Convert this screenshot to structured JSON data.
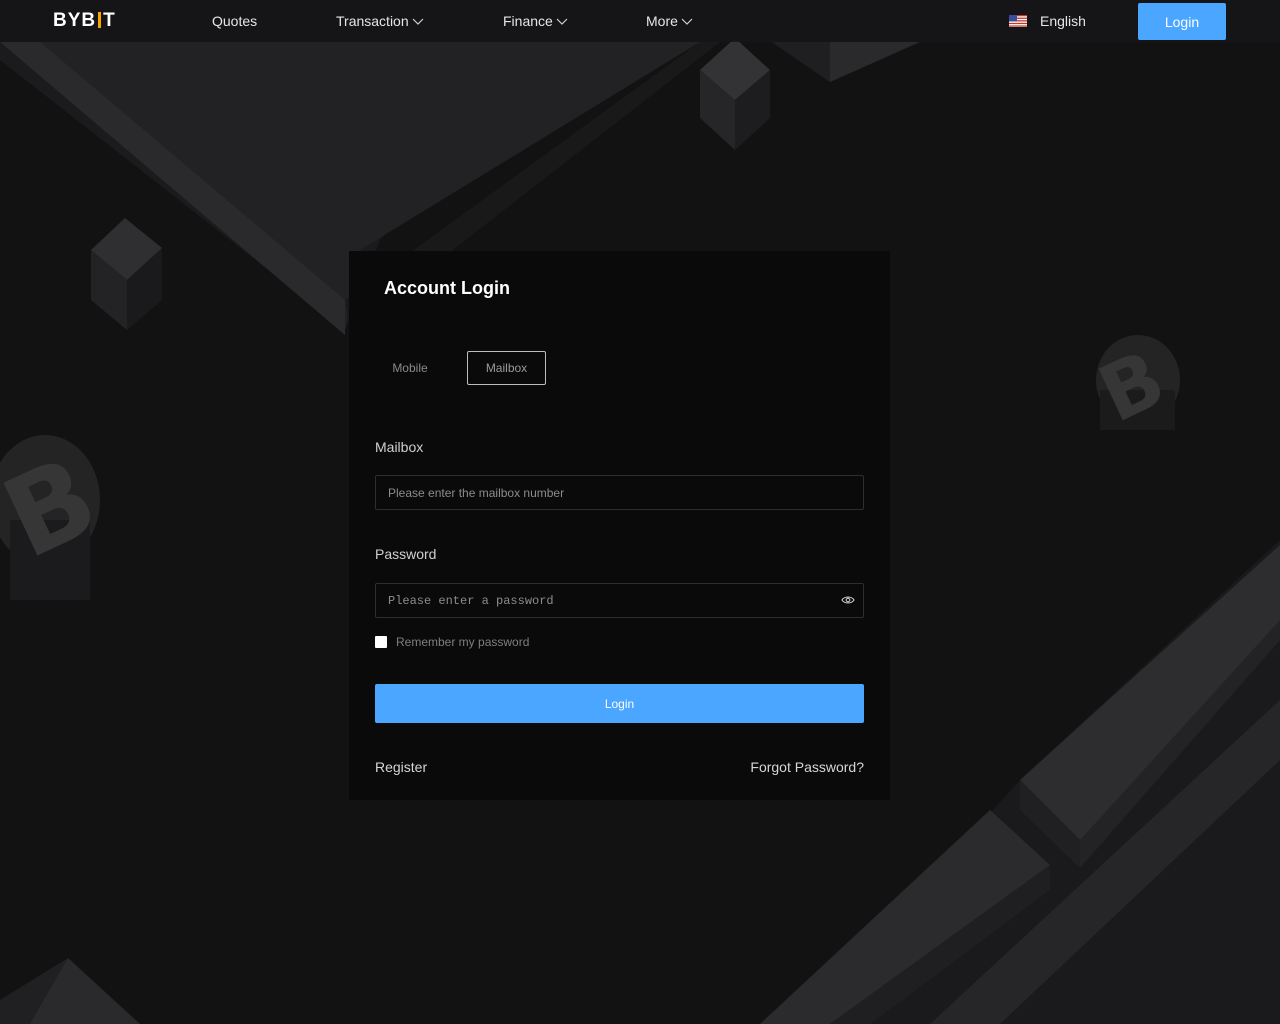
{
  "header": {
    "logo_left": "BYB",
    "logo_right": "T",
    "nav": [
      {
        "label": "Quotes",
        "has_dropdown": false
      },
      {
        "label": "Transaction",
        "has_dropdown": true
      },
      {
        "label": "Finance",
        "has_dropdown": true
      },
      {
        "label": "More",
        "has_dropdown": true
      }
    ],
    "language": {
      "label": "English",
      "flag_icon": "us-flag-icon"
    },
    "login_label": "Login"
  },
  "colors": {
    "accent": "#4aa6ff",
    "logo_accent": "#f7a600",
    "background": "#121213",
    "card_background": "#0a0a0b"
  },
  "login_card": {
    "title": "Account Login",
    "tabs": [
      {
        "label": "Mobile",
        "active": false
      },
      {
        "label": "Mailbox",
        "active": true
      }
    ],
    "mailbox_label": "Mailbox",
    "mailbox_placeholder": "Please enter the mailbox number",
    "password_label": "Password",
    "password_placeholder": "Please enter a password",
    "password_toggle_icon": "eye-icon",
    "remember_label": "Remember my password",
    "remember_checked": false,
    "submit_label": "Login",
    "register_label": "Register",
    "forgot_label": "Forgot Password?"
  }
}
